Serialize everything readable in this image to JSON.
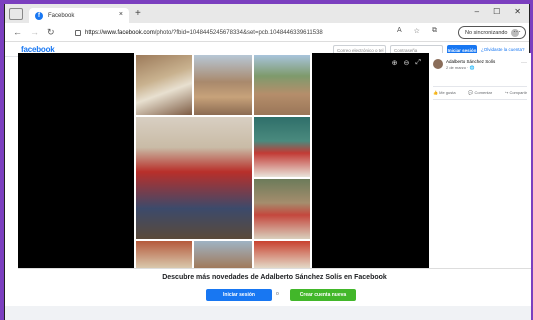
{
  "browser": {
    "tab_title": "Facebook",
    "tab_close": "×",
    "new_tab": "+",
    "url_prefix": "https://www.facebook.com",
    "url_rest": "/photo/?fbid=1048445245678334&set=pcb.1048446339611538",
    "sync_label": "No sincronizando",
    "more": "···",
    "nav_back": "←",
    "nav_forward": "→",
    "nav_refresh": "↻",
    "win_min": "–",
    "win_max": "☐",
    "win_close": "✕"
  },
  "facebook": {
    "logo": "facebook",
    "email_placeholder": "Correo electrónico o tel",
    "password_placeholder": "Contraseña",
    "login_button": "Iniciar sesión",
    "forgot_link": "¿Olvidaste la cuenta?"
  },
  "post": {
    "author": "Adalberto Sánchez Solís",
    "date": "2 de marzo · 🌐",
    "more": "···",
    "like": "Me gusta",
    "comment": "Comentar",
    "share": "Compartir"
  },
  "viewer": {
    "zoom_in": "⊕",
    "zoom_out": "⊖",
    "fullscreen": "⤢"
  },
  "banner": {
    "text": "Descubre más novedades de Adalberto Sánchez Solís en Facebook",
    "login_button": "Iniciar sesión",
    "or": "o",
    "create_button": "Crear cuenta nueva"
  },
  "colors": {
    "accent": "#1877f2",
    "create": "#42b72a",
    "frame": "#7b3fbf"
  }
}
